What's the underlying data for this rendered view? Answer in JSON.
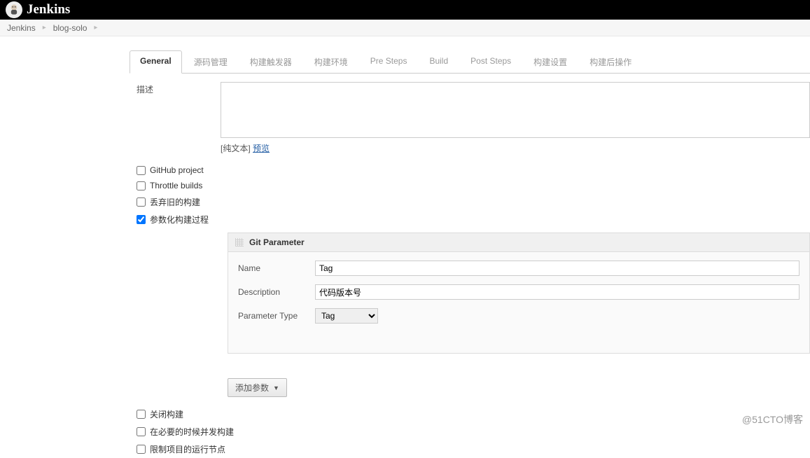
{
  "topbar": {
    "title": "Jenkins"
  },
  "breadcrumb": {
    "root": "Jenkins",
    "project": "blog-solo"
  },
  "tabs": [
    {
      "label": "General",
      "active": true
    },
    {
      "label": "源码管理"
    },
    {
      "label": "构建触发器"
    },
    {
      "label": "构建环境"
    },
    {
      "label": "Pre Steps"
    },
    {
      "label": "Build"
    },
    {
      "label": "Post Steps"
    },
    {
      "label": "构建设置"
    },
    {
      "label": "构建后操作"
    }
  ],
  "form": {
    "description_label": "描述",
    "description_value": "",
    "hint_plain": "[纯文本]",
    "hint_preview": "预览"
  },
  "checks": {
    "github": {
      "label": "GitHub project",
      "checked": false
    },
    "throttle": {
      "label": "Throttle builds",
      "checked": false
    },
    "discard": {
      "label": "丢弃旧的构建",
      "checked": false
    },
    "param": {
      "label": "参数化构建过程",
      "checked": true
    },
    "disable": {
      "label": "关闭构建",
      "checked": false
    },
    "concurrent": {
      "label": "在必要的时候并发构建",
      "checked": false
    },
    "restrict": {
      "label": "限制项目的运行节点",
      "checked": false
    }
  },
  "git_param": {
    "title": "Git Parameter",
    "name_label": "Name",
    "name_value": "Tag",
    "desc_label": "Description",
    "desc_value": "代码版本号",
    "type_label": "Parameter Type",
    "type_value": "Tag"
  },
  "add_param": {
    "label": "添加参数"
  },
  "watermark": "@51CTO博客"
}
